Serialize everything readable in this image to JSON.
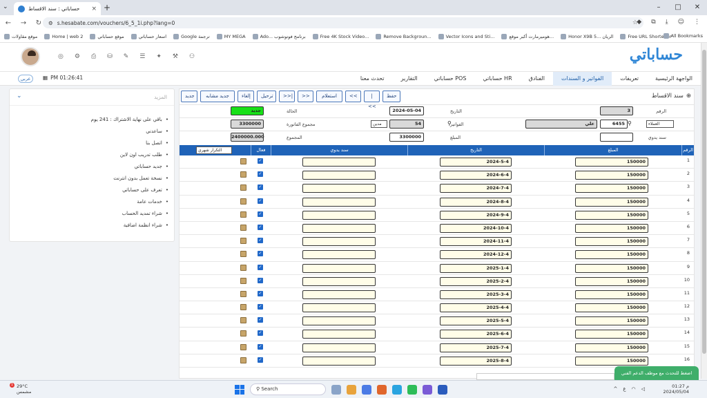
{
  "browser": {
    "tab_title": "حساباتي : سند الاقساط",
    "url": "s.hesabate.com/vouchers/6_5_1i.php?lang=0",
    "bookmarks": [
      "موقع مقاولات",
      "Home | web 2",
      "موقع حساباتي",
      "اسعار حساباتي",
      "Google ترجمة",
      "MY MEGA",
      "Ado... برنامج فوتوشوب",
      "Free 4K Stock Video...",
      "Remove Backgroun...",
      "Vector Icons and Sti...",
      "هوميرمارت أكبر موقع...",
      "Honor X9B 5... الريان",
      "Free URL Shortener"
    ],
    "all_bookmarks": "All Bookmarks"
  },
  "header": {
    "logo": "حساباتي",
    "menu": [
      "الواجهة الرئيسية",
      "تعريفات",
      "الفواتير و السندات",
      "الفنادق",
      "حساباتي HR",
      "حساباتي POS",
      "التقارير",
      "تحدث معنا"
    ],
    "active_menu": "الفواتير و السندات",
    "lang": "عربي",
    "time": "PM 01:26:41"
  },
  "left_panel": {
    "title": "المزيد",
    "items": [
      "باقي على نهاية الاشتراك : 241 يوم",
      "ساعدني",
      "اتصل بنا",
      "طلب تدريب اون لاين",
      "جديد حساباتي",
      "نسخة تعمل بدون انترنت",
      "تعرف على حساباتي",
      "خدمات عامة",
      "شراء تمديد الحساب",
      "شراء انظمة اضافية"
    ]
  },
  "main": {
    "title": "سند الاقساط",
    "toolbar": [
      "حفظ",
      "|<<",
      "<<",
      "استعلام",
      ">>",
      ">>|",
      "ترحيل",
      "إلغاء",
      "جديد مشابه",
      "جديد"
    ],
    "form": {
      "number_label": "الرقم",
      "number": "3",
      "date_label": "التاريخ",
      "date": "2024-05-04",
      "status_label": "الحالة",
      "status": "جديد",
      "customers_select": "العملاء",
      "customer_code": "6455",
      "customer_name": "علي",
      "invoices_label": "الفواتير",
      "invoice": "54",
      "invoice_type": "مدين",
      "invoice_total_label": "مجموع الفاتورة",
      "invoice_total": "3300000",
      "doc_label": "سند يدوي",
      "amount_label": "المبلغ",
      "amount": "3300000",
      "total_label": "المجموع",
      "total": "2400000.000"
    },
    "table": {
      "headers": [
        "الرقم",
        "المبلغ",
        "التاريخ",
        "سند يدوي",
        "فعال"
      ],
      "repeat_select": "التكرار شهري",
      "rows": [
        {
          "n": "1",
          "amount": "150000",
          "date": "2024-5-4"
        },
        {
          "n": "2",
          "amount": "150000",
          "date": "2024-6-4"
        },
        {
          "n": "3",
          "amount": "150000",
          "date": "2024-7-4"
        },
        {
          "n": "4",
          "amount": "150000",
          "date": "2024-8-4"
        },
        {
          "n": "5",
          "amount": "150000",
          "date": "2024-9-4"
        },
        {
          "n": "6",
          "amount": "150000",
          "date": "2024-10-4"
        },
        {
          "n": "7",
          "amount": "150000",
          "date": "2024-11-4"
        },
        {
          "n": "8",
          "amount": "150000",
          "date": "2024-12-4"
        },
        {
          "n": "9",
          "amount": "150000",
          "date": "2025-1-4"
        },
        {
          "n": "10",
          "amount": "150000",
          "date": "2025-2-4"
        },
        {
          "n": "11",
          "amount": "150000",
          "date": "2025-3-4"
        },
        {
          "n": "12",
          "amount": "150000",
          "date": "2025-4-4"
        },
        {
          "n": "13",
          "amount": "150000",
          "date": "2025-5-4"
        },
        {
          "n": "14",
          "amount": "150000",
          "date": "2025-6-4"
        },
        {
          "n": "15",
          "amount": "150000",
          "date": "2025-7-4"
        },
        {
          "n": "16",
          "amount": "150000",
          "date": "2025-8-4"
        }
      ]
    }
  },
  "chat": "اضغط للتحدث مع موظف الدعم الفني",
  "taskbar": {
    "temp": "29°C",
    "weather": "مشمس",
    "badge": "1",
    "search": "Search",
    "time": "01:27 م",
    "date": "2024/05/04"
  }
}
